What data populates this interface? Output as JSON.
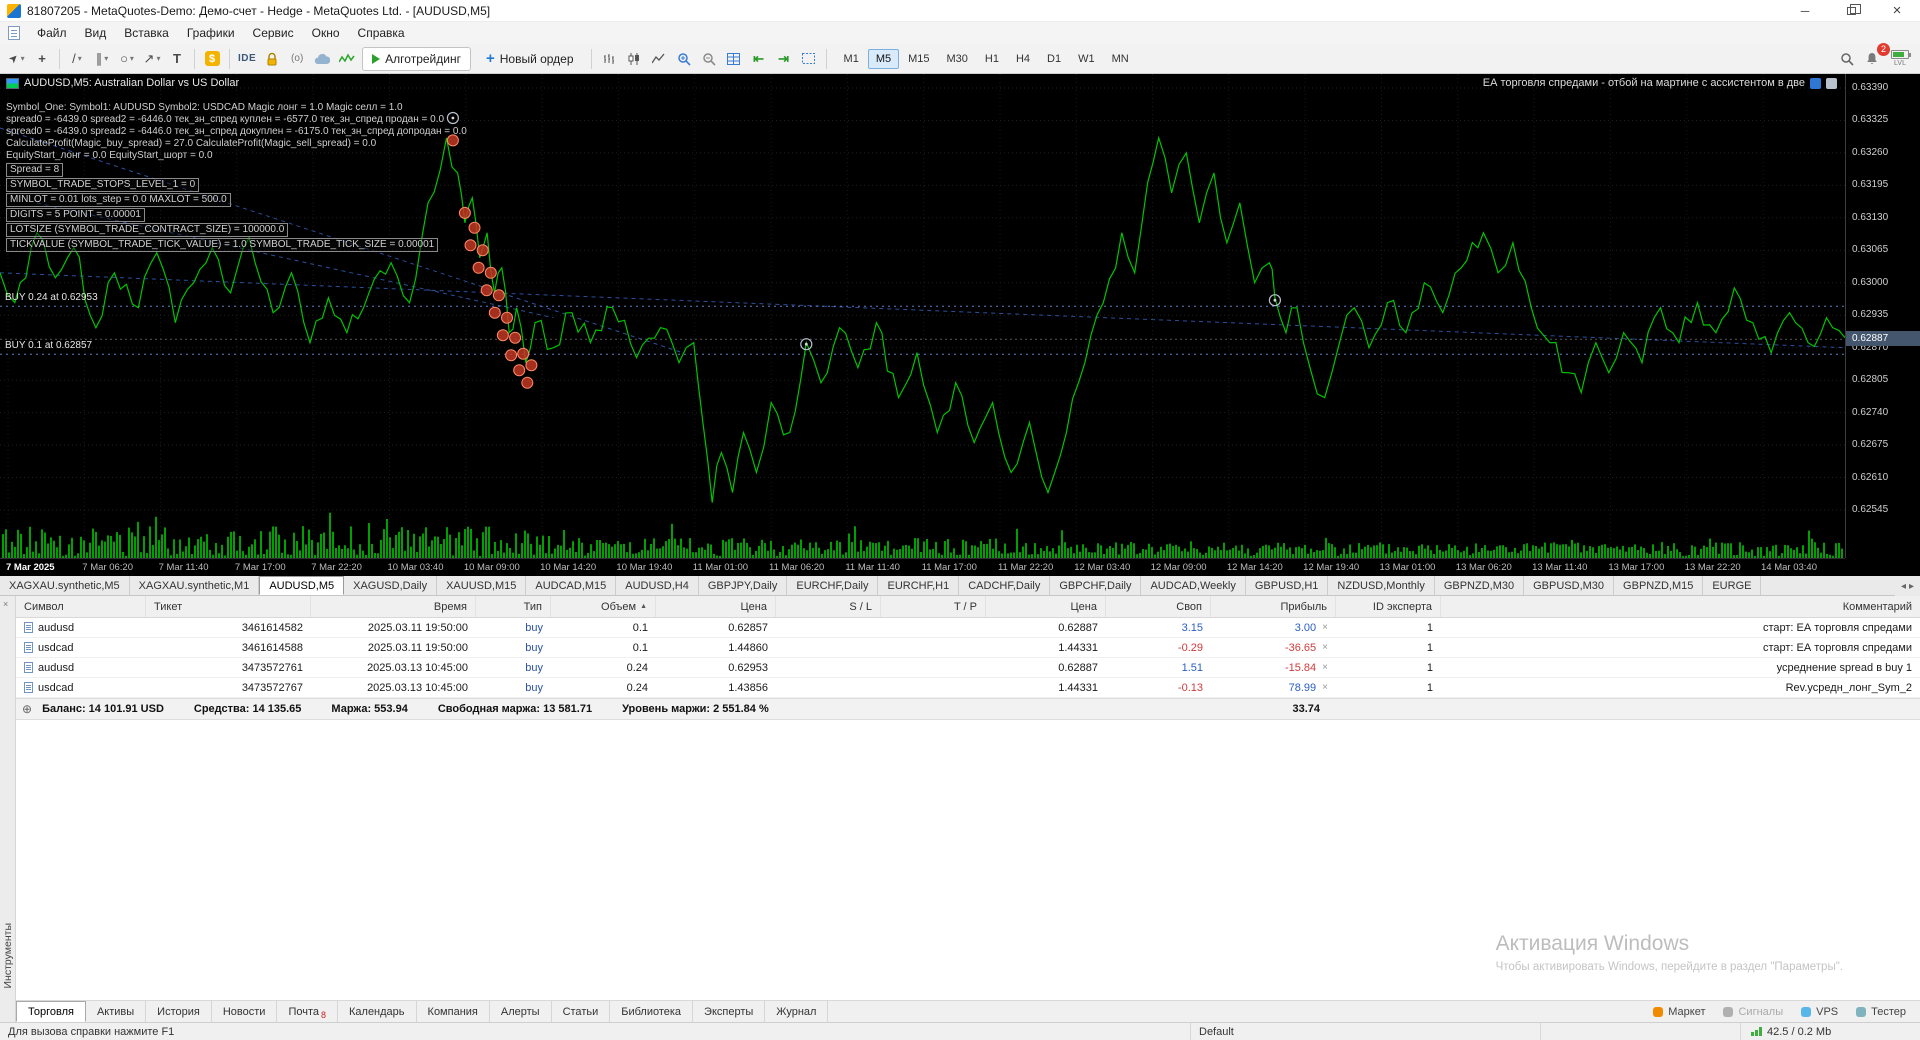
{
  "window": {
    "title": "81807205 - MetaQuotes-Demo: Демо-счет - Hedge - MetaQuotes Ltd. - [AUDUSD,M5]"
  },
  "icons": {
    "cursor": "➤",
    "crosshair": "+",
    "trendline": "/",
    "channel": "∥",
    "ellipse": "○",
    "arrow": "↗",
    "text": "T",
    "caret": "▾",
    "dollar": "$",
    "webrequest": "(o)",
    "dock_left": "⇤",
    "dock_right": "⇥",
    "sort_asc": "▲",
    "close": "×",
    "minimize": "─",
    "balance_plus": "⊕",
    "chevron_left": "◂",
    "chevron_right": "▸"
  },
  "menu": [
    {
      "label": "Файл"
    },
    {
      "label": "Вид"
    },
    {
      "label": "Вставка"
    },
    {
      "label": "Графики"
    },
    {
      "label": "Сервис"
    },
    {
      "label": "Окно"
    },
    {
      "label": "Справка"
    }
  ],
  "toolbar": {
    "ide_label": "IDE",
    "algo_trading_label": "Алготрейдинг",
    "new_order_label": "Новый ордер",
    "notification_count": "2",
    "battery_label": "LVL",
    "timeframes": [
      {
        "label": "M1"
      },
      {
        "label": "M5",
        "active": true
      },
      {
        "label": "M15"
      },
      {
        "label": "M30"
      },
      {
        "label": "H1"
      },
      {
        "label": "H4"
      },
      {
        "label": "D1"
      },
      {
        "label": "W1"
      },
      {
        "label": "MN"
      }
    ]
  },
  "chart": {
    "symbol_header": "AUDUSD,M5:  Australian Dollar vs US Dollar",
    "ea_comment": "ЕА торговля спредами - отбой на мартине с ассистентом в две",
    "ea_lines": [
      {
        "text": "Symbol_One:  Symbol1: AUDUSD Symbol2: USDCAD Magic лонг = 1.0 Magic селл = 1.0",
        "boxed": false
      },
      {
        "text": "spread0 = -6439.0 spread2 = -6446.0 тек_зн_спред куплен = -6577.0  тек_зн_спред продан = 0.0",
        "boxed": false
      },
      {
        "text": "spread0 = -6439.0 spread2 = -6446.0 тек_зн_спред докуплен = -6175.0 тек_зн_спред допродан = 0.0",
        "boxed": false
      },
      {
        "text": "CalculateProfit(Magic_buy_spread) = 27.0 CalculateProfit(Magic_sell_spread) = 0.0",
        "boxed": false
      },
      {
        "text": "EquityStart_лонг = 0.0 EquityStart_шорт = 0.0",
        "boxed": false
      },
      {
        "text": "Spread = 8",
        "boxed": true
      },
      {
        "text": "SYMBOL_TRADE_STOPS_LEVEL_1 = 0",
        "boxed": true
      },
      {
        "text": "MINLOT = 0.01 lots_step = 0.0 MAXLOT = 500.0",
        "boxed": true
      },
      {
        "text": "DIGITS = 5 POINT = 0.00001",
        "boxed": true
      },
      {
        "text": "LOTSIZE (SYMBOL_TRADE_CONTRACT_SIZE) = 100000.0",
        "boxed": true
      },
      {
        "text": "TICKVALUE (SYMBOL_TRADE_TICK_VALUE) = 1.0 SYMBOL_TRADE_TICK_SIZE = 0.00001",
        "boxed": true
      }
    ],
    "buy_labels": [
      {
        "text": "BUY 0.24 at 0.62953",
        "price": 0.62953
      },
      {
        "text": "BUY 0.1 at 0.62857",
        "price": 0.62857
      }
    ],
    "current_price": "0.62887"
  },
  "chart_data": {
    "type": "line",
    "title": "AUDUSD,M5",
    "price_max": 0.6339,
    "price_min": 0.62545,
    "current_price": 0.62887,
    "price_ticks": [
      "0.63390",
      "0.63325",
      "0.63260",
      "0.63195",
      "0.63130",
      "0.63065",
      "0.63000",
      "0.62935",
      "0.62870",
      "0.62805",
      "0.62740",
      "0.62675",
      "0.62610",
      "0.62545"
    ],
    "time_ticks": [
      "7 Mar 2025",
      "7 Mar 06:20",
      "7 Mar 11:40",
      "7 Mar 17:00",
      "7 Mar 22:20",
      "10 Mar 03:40",
      "10 Mar 09:00",
      "10 Mar 14:20",
      "10 Mar 19:40",
      "11 Mar 01:00",
      "11 Mar 06:20",
      "11 Mar 11:40",
      "11 Mar 17:00",
      "11 Mar 22:20",
      "12 Mar 03:40",
      "12 Mar 09:00",
      "12 Mar 14:20",
      "12 Mar 19:40",
      "13 Mar 01:00",
      "13 Mar 06:20",
      "13 Mar 11:40",
      "13 Mar 17:00",
      "13 Mar 22:20",
      "14 Mar 03:40"
    ],
    "series": [
      [
        0.0,
        0.6302
      ],
      [
        0.008,
        0.6296
      ],
      [
        0.02,
        0.631
      ],
      [
        0.03,
        0.6301
      ],
      [
        0.04,
        0.6307
      ],
      [
        0.052,
        0.6291
      ],
      [
        0.062,
        0.6302
      ],
      [
        0.075,
        0.6295
      ],
      [
        0.085,
        0.6306
      ],
      [
        0.095,
        0.6292
      ],
      [
        0.105,
        0.63
      ],
      [
        0.115,
        0.6307
      ],
      [
        0.125,
        0.6298
      ],
      [
        0.135,
        0.6309
      ],
      [
        0.148,
        0.6294
      ],
      [
        0.158,
        0.6302
      ],
      [
        0.168,
        0.6288
      ],
      [
        0.178,
        0.6297
      ],
      [
        0.188,
        0.629
      ],
      [
        0.2,
        0.6298
      ],
      [
        0.212,
        0.6304
      ],
      [
        0.222,
        0.6296
      ],
      [
        0.232,
        0.6316
      ],
      [
        0.242,
        0.6329
      ],
      [
        0.248,
        0.6322
      ],
      [
        0.252,
        0.6312
      ],
      [
        0.256,
        0.6317
      ],
      [
        0.26,
        0.6305
      ],
      [
        0.264,
        0.631
      ],
      [
        0.268,
        0.6298
      ],
      [
        0.272,
        0.6303
      ],
      [
        0.276,
        0.629
      ],
      [
        0.28,
        0.6295
      ],
      [
        0.285,
        0.6284
      ],
      [
        0.29,
        0.6292
      ],
      [
        0.3,
        0.6287
      ],
      [
        0.31,
        0.6294
      ],
      [
        0.32,
        0.6288
      ],
      [
        0.332,
        0.6295
      ],
      [
        0.345,
        0.6285
      ],
      [
        0.358,
        0.6291
      ],
      [
        0.368,
        0.6284
      ],
      [
        0.376,
        0.6288
      ],
      [
        0.381,
        0.6272
      ],
      [
        0.386,
        0.6256
      ],
      [
        0.391,
        0.6266
      ],
      [
        0.397,
        0.6258
      ],
      [
        0.403,
        0.627
      ],
      [
        0.41,
        0.6262
      ],
      [
        0.418,
        0.6276
      ],
      [
        0.428,
        0.627
      ],
      [
        0.437,
        0.6288
      ],
      [
        0.445,
        0.628
      ],
      [
        0.455,
        0.6291
      ],
      [
        0.465,
        0.6283
      ],
      [
        0.475,
        0.6292
      ],
      [
        0.487,
        0.6277
      ],
      [
        0.497,
        0.6286
      ],
      [
        0.508,
        0.627
      ],
      [
        0.518,
        0.628
      ],
      [
        0.528,
        0.6268
      ],
      [
        0.538,
        0.6276
      ],
      [
        0.548,
        0.6262
      ],
      [
        0.558,
        0.6272
      ],
      [
        0.568,
        0.6258
      ],
      [
        0.578,
        0.627
      ],
      [
        0.588,
        0.6284
      ],
      [
        0.598,
        0.6296
      ],
      [
        0.608,
        0.631
      ],
      [
        0.615,
        0.6302
      ],
      [
        0.622,
        0.632
      ],
      [
        0.628,
        0.6329
      ],
      [
        0.635,
        0.6318
      ],
      [
        0.643,
        0.6326
      ],
      [
        0.65,
        0.6312
      ],
      [
        0.658,
        0.6322
      ],
      [
        0.665,
        0.6308
      ],
      [
        0.672,
        0.6316
      ],
      [
        0.68,
        0.63
      ],
      [
        0.688,
        0.6304
      ],
      [
        0.691,
        0.6297
      ],
      [
        0.697,
        0.629
      ],
      [
        0.703,
        0.6295
      ],
      [
        0.71,
        0.6283
      ],
      [
        0.718,
        0.6277
      ],
      [
        0.726,
        0.6288
      ],
      [
        0.734,
        0.6295
      ],
      [
        0.742,
        0.6287
      ],
      [
        0.752,
        0.6296
      ],
      [
        0.762,
        0.629
      ],
      [
        0.772,
        0.63
      ],
      [
        0.782,
        0.6294
      ],
      [
        0.792,
        0.6303
      ],
      [
        0.804,
        0.631
      ],
      [
        0.812,
        0.6302
      ],
      [
        0.82,
        0.6308
      ],
      [
        0.83,
        0.6295
      ],
      [
        0.84,
        0.6288
      ],
      [
        0.85,
        0.6282
      ],
      [
        0.857,
        0.6278
      ],
      [
        0.865,
        0.6288
      ],
      [
        0.872,
        0.6282
      ],
      [
        0.88,
        0.629
      ],
      [
        0.89,
        0.6284
      ],
      [
        0.9,
        0.6295
      ],
      [
        0.91,
        0.6288
      ],
      [
        0.92,
        0.6296
      ],
      [
        0.93,
        0.629
      ],
      [
        0.94,
        0.6299
      ],
      [
        0.95,
        0.6292
      ],
      [
        0.96,
        0.6286
      ],
      [
        0.97,
        0.6294
      ],
      [
        0.98,
        0.6288
      ],
      [
        0.99,
        0.6293
      ],
      [
        1.0,
        0.6289
      ]
    ],
    "markers_red": [
      [
        0.2455,
        0.63285
      ],
      [
        0.252,
        0.6314
      ],
      [
        0.255,
        0.63075
      ],
      [
        0.2572,
        0.6311
      ],
      [
        0.2594,
        0.6303
      ],
      [
        0.2616,
        0.63065
      ],
      [
        0.2638,
        0.62985
      ],
      [
        0.266,
        0.6302
      ],
      [
        0.2682,
        0.6294
      ],
      [
        0.2704,
        0.62975
      ],
      [
        0.2726,
        0.62895
      ],
      [
        0.2748,
        0.6293
      ],
      [
        0.277,
        0.62855
      ],
      [
        0.2792,
        0.6289
      ],
      [
        0.2814,
        0.62825
      ],
      [
        0.2836,
        0.62858
      ],
      [
        0.2858,
        0.628
      ],
      [
        0.288,
        0.62835
      ]
    ],
    "markers_gray": [
      [
        0.2455,
        0.6333
      ],
      [
        0.437,
        0.62877
      ],
      [
        0.691,
        0.62965
      ]
    ],
    "trend_lines": [
      {
        "x1": 0.0,
        "p1": 0.6331,
        "x2": 0.37,
        "p2": 0.6286
      },
      {
        "x1": 0.02,
        "p1": 0.6316,
        "x2": 0.3,
        "p2": 0.6293
      },
      {
        "x1": 0.0,
        "p1": 0.6302,
        "x2": 1.0,
        "p2": 0.6287
      }
    ],
    "legend_position": "none",
    "grid": true
  },
  "chart_tabs": [
    {
      "label": "XAGXAU.synthetic,M5"
    },
    {
      "label": "XAGXAU.synthetic,M1"
    },
    {
      "label": "AUDUSD,M5",
      "active": true
    },
    {
      "label": "XAGUSD,Daily"
    },
    {
      "label": "XAUUSD,M15"
    },
    {
      "label": "AUDCAD,M15"
    },
    {
      "label": "AUDUSD,H4"
    },
    {
      "label": "GBPJPY,Daily"
    },
    {
      "label": "EURCHF,Daily"
    },
    {
      "label": "EURCHF,H1"
    },
    {
      "label": "CADCHF,Daily"
    },
    {
      "label": "GBPCHF,Daily"
    },
    {
      "label": "AUDCAD,Weekly"
    },
    {
      "label": "GBPUSD,H1"
    },
    {
      "label": "NZDUSD,Monthly"
    },
    {
      "label": "GBPNZD,M30"
    },
    {
      "label": "GBPUSD,M30"
    },
    {
      "label": "GBPNZD,M15"
    },
    {
      "label": "EURGE"
    }
  ],
  "toolbox": {
    "panel_title": "Инструменты",
    "columns": {
      "symbol": "Символ",
      "ticket": "Тикет",
      "time": "Время",
      "type": "Тип",
      "volume": "Объем",
      "price_open": "Цена",
      "sl": "S / L",
      "tp": "T / P",
      "price_cur": "Цена",
      "swap": "Своп",
      "profit": "Прибыль",
      "expert_id": "ID экспер­та",
      "comment": "Комментарий"
    },
    "rows": [
      {
        "symbol": "audusd",
        "ticket": "3461614582",
        "time": "2025.03.11 19:50:00",
        "type": "buy",
        "volume": "0.1",
        "price_open": "0.62857",
        "sl": "",
        "tp": "",
        "price_cur": "0.62887",
        "swap": "3.15",
        "swap_neg": false,
        "profit": "3.00",
        "profit_neg": false,
        "expert_id": "1",
        "comment": "старт: ЕА торговля спредами"
      },
      {
        "symbol": "usdcad",
        "ticket": "3461614588",
        "time": "2025.03.11 19:50:00",
        "type": "buy",
        "volume": "0.1",
        "price_open": "1.44860",
        "sl": "",
        "tp": "",
        "price_cur": "1.44331",
        "swap": "-0.29",
        "swap_neg": true,
        "profit": "-36.65",
        "profit_neg": true,
        "expert_id": "1",
        "comment": "старт: ЕА торговля спредами"
      },
      {
        "symbol": "audusd",
        "ticket": "3473572761",
        "time": "2025.03.13 10:45:00",
        "type": "buy",
        "volume": "0.24",
        "price_open": "0.62953",
        "sl": "",
        "tp": "",
        "price_cur": "0.62887",
        "swap": "1.51",
        "swap_neg": false,
        "profit": "-15.84",
        "profit_neg": true,
        "expert_id": "1",
        "comment": "усреднение spread в buy 1"
      },
      {
        "symbol": "usdcad",
        "ticket": "3473572767",
        "time": "2025.03.13 10:45:00",
        "type": "buy",
        "volume": "0.24",
        "price_open": "1.43856",
        "sl": "",
        "tp": "",
        "price_cur": "1.44331",
        "swap": "-0.13",
        "swap_neg": true,
        "profit": "78.99",
        "profit_neg": false,
        "expert_id": "1",
        "comment": "Rev.усредн_лонг_Sym_2"
      }
    ],
    "summary": {
      "balance": "Баланс: 14 101.91 USD",
      "equity": "Средства: 14 135.65",
      "margin": "Маржа: 553.94",
      "free_margin": "Свободная маржа: 13 581.71",
      "margin_level": "Уровень маржи: 2 551.84 %",
      "profit_total": "33.74"
    },
    "bottom_tabs": [
      {
        "label": "Торговля",
        "active": true
      },
      {
        "label": "Активы"
      },
      {
        "label": "История"
      },
      {
        "label": "Новости"
      },
      {
        "label": "Почта",
        "badge": "8"
      },
      {
        "label": "Календарь"
      },
      {
        "label": "Компания"
      },
      {
        "label": "Алерты"
      },
      {
        "label": "Статьи"
      },
      {
        "label": "Библиотека"
      },
      {
        "label": "Эксперты"
      },
      {
        "label": "Журнал"
      }
    ],
    "right_buttons": [
      {
        "label": "Маркет",
        "color": "#f08a00"
      },
      {
        "label": "Сигналы",
        "color": "#b0b0b0",
        "muted": true
      },
      {
        "label": "VPS",
        "color": "#58b7e8"
      },
      {
        "label": "Тестер",
        "color": "#7fb3be"
      }
    ]
  },
  "watermark": {
    "line1": "Активация Windows",
    "line2": "Чтобы активировать Windows, перейдите в раздел \"Параметры\"."
  },
  "statusbar": {
    "help": "Для вызова справки нажмите F1",
    "profile": "Default",
    "traffic": "42.5 / 0.2 Mb"
  }
}
